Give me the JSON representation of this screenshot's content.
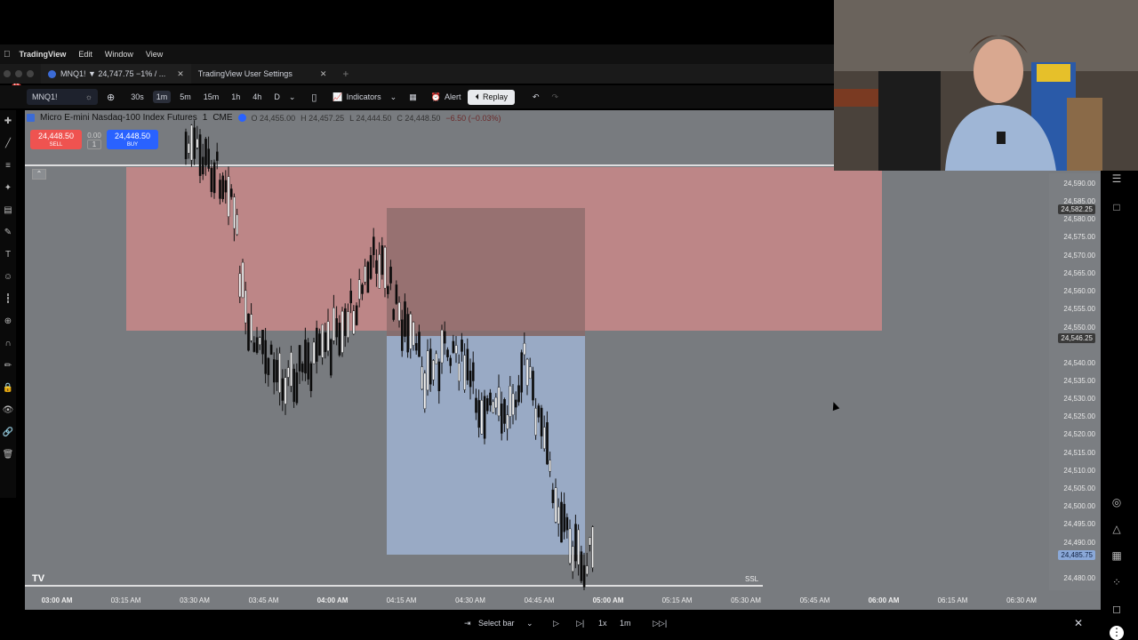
{
  "menubar": {
    "app_name": "TradingView",
    "items": [
      "Edit",
      "Window",
      "View"
    ]
  },
  "tabs": [
    {
      "label": "MNQ1! ▼ 24,747.75 −1% / ...",
      "active": true
    },
    {
      "label": "TradingView User Settings",
      "active": false
    }
  ],
  "notification_count": "11",
  "toolbar": {
    "symbol": "MNQ1!",
    "timeframes": [
      "30s",
      "1m",
      "5m",
      "15m",
      "1h",
      "4h",
      "D"
    ],
    "selected_timeframe": "1m",
    "indicators_label": "Indicators",
    "alert_label": "Alert",
    "replay_label": "Replay"
  },
  "header": {
    "instrument": "Micro E-mini Nasdaq-100 Index Futures",
    "interval": "1",
    "exchange": "CME",
    "open": "O 24,455.00",
    "high": "H 24,457.25",
    "low": "L 24,444.50",
    "close": "C 24,448.50",
    "change": "−6.50 (−0.03%)"
  },
  "trade": {
    "sell_price": "24,448.50",
    "sell_label": "SELL",
    "spread": "0.00",
    "qty": "1",
    "buy_price": "24,448.50",
    "buy_label": "BUY"
  },
  "price_axis": {
    "labels": [
      "24,590.00",
      "24,585.00",
      "24,580.00",
      "24,575.00",
      "24,570.00",
      "24,565.00",
      "24,560.00",
      "24,555.00",
      "24,550.00",
      "24,540.00",
      "24,535.00",
      "24,530.00",
      "24,525.00",
      "24,520.00",
      "24,515.00",
      "24,510.00",
      "24,505.00",
      "24,500.00",
      "24,495.00",
      "24,490.00",
      "24,480.00"
    ],
    "tag_upper": "24,582.25",
    "tag_mid": "24,546.25",
    "tag_current": "24,485.75"
  },
  "time_axis": {
    "labels": [
      {
        "t": "03:00 AM",
        "bold": true
      },
      {
        "t": "03:15 AM",
        "bold": false
      },
      {
        "t": "03:30 AM",
        "bold": false
      },
      {
        "t": "03:45 AM",
        "bold": false
      },
      {
        "t": "04:00 AM",
        "bold": true
      },
      {
        "t": "04:15 AM",
        "bold": false
      },
      {
        "t": "04:30 AM",
        "bold": false
      },
      {
        "t": "04:45 AM",
        "bold": false
      },
      {
        "t": "05:00 AM",
        "bold": true
      },
      {
        "t": "05:15 AM",
        "bold": false
      },
      {
        "t": "05:30 AM",
        "bold": false
      },
      {
        "t": "05:45 AM",
        "bold": false
      },
      {
        "t": "06:00 AM",
        "bold": true
      },
      {
        "t": "06:15 AM",
        "bold": false
      },
      {
        "t": "06:30 AM",
        "bold": false
      }
    ]
  },
  "annotations": {
    "ssl": "SSL"
  },
  "replay_bar": {
    "select_bar": "Select bar",
    "speed": "1x",
    "interval": "1m"
  },
  "colors": {
    "chart_bg": "#787b7f",
    "supply_zone": "#c98888",
    "demand_zone": "#9fb3d1",
    "sell": "#ef5350",
    "buy": "#2962ff"
  }
}
